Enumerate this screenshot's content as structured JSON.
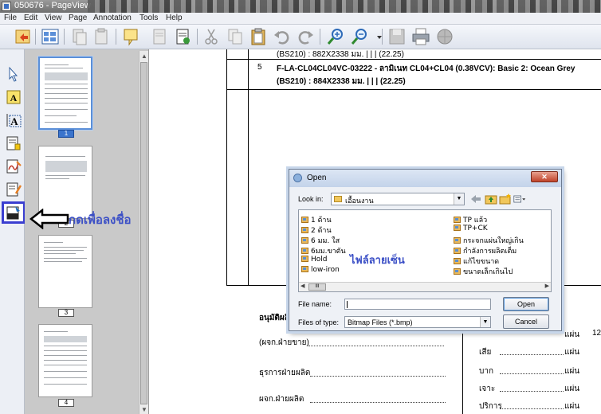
{
  "window": {
    "title": "050676 - PageView"
  },
  "menu": [
    "File",
    "Edit",
    "View",
    "Page",
    "Annotation",
    "Tools",
    "Help"
  ],
  "thumbnails": [
    {
      "page": "1",
      "active": true
    },
    {
      "page": "2",
      "active": false
    },
    {
      "page": "3",
      "active": false
    },
    {
      "page": "4",
      "active": false
    }
  ],
  "annotations": {
    "arrow_label": "กดเพื่อลงชื่อ",
    "signature_label": "ไฟล์ลายเซ็น"
  },
  "document": {
    "row_top_partial": "(BS210) : 882X2338  มม. |  |  |  (22.25)",
    "row5_number": "5",
    "row5_line1": "F-LA-CL04CL04VC-03222 - ลามิเนท CL04+CL04 (0.38VCV): Basic 2: Ocean Grey",
    "row5_line2": "(BS210) : 884X2338  มม. |  |  |  (22.25)",
    "approve_label": "อนุมัติผลิ",
    "sign1": "(ผจก.ฝ่ายขาย)",
    "sign2": "ธุรการฝ่ายผลิต",
    "sign3": "ผจก.ฝ่ายผลิต",
    "unit": "แผ่น",
    "right_number": "12",
    "right_labels": [
      "เสีย",
      "บาก",
      "เจาะ",
      "ปริการ"
    ]
  },
  "dialog": {
    "title": "Open",
    "look_in_label": "Look in:",
    "look_in_value": "เอื้อนงาน",
    "files_col1": [
      "1 ด้าน",
      "2 ด้าน",
      "6 มม. ใส",
      "6มม.ขาตัน",
      "Hold",
      "low-iron"
    ],
    "files_col2": [
      "TP แล้ว",
      "TP+CK",
      "กระจกแผ่นใหญ่เกิน",
      "กำลังการผลิตเต็ม",
      "แก้ไขขนาด",
      "ขนาดเล็กเกินไป"
    ],
    "file_name_label": "File name:",
    "file_name_value": "",
    "file_type_label": "Files of type:",
    "file_type_value": "Bitmap Files (*.bmp)",
    "open_button": "Open",
    "cancel_button": "Cancel",
    "scroll_grip": "III"
  }
}
